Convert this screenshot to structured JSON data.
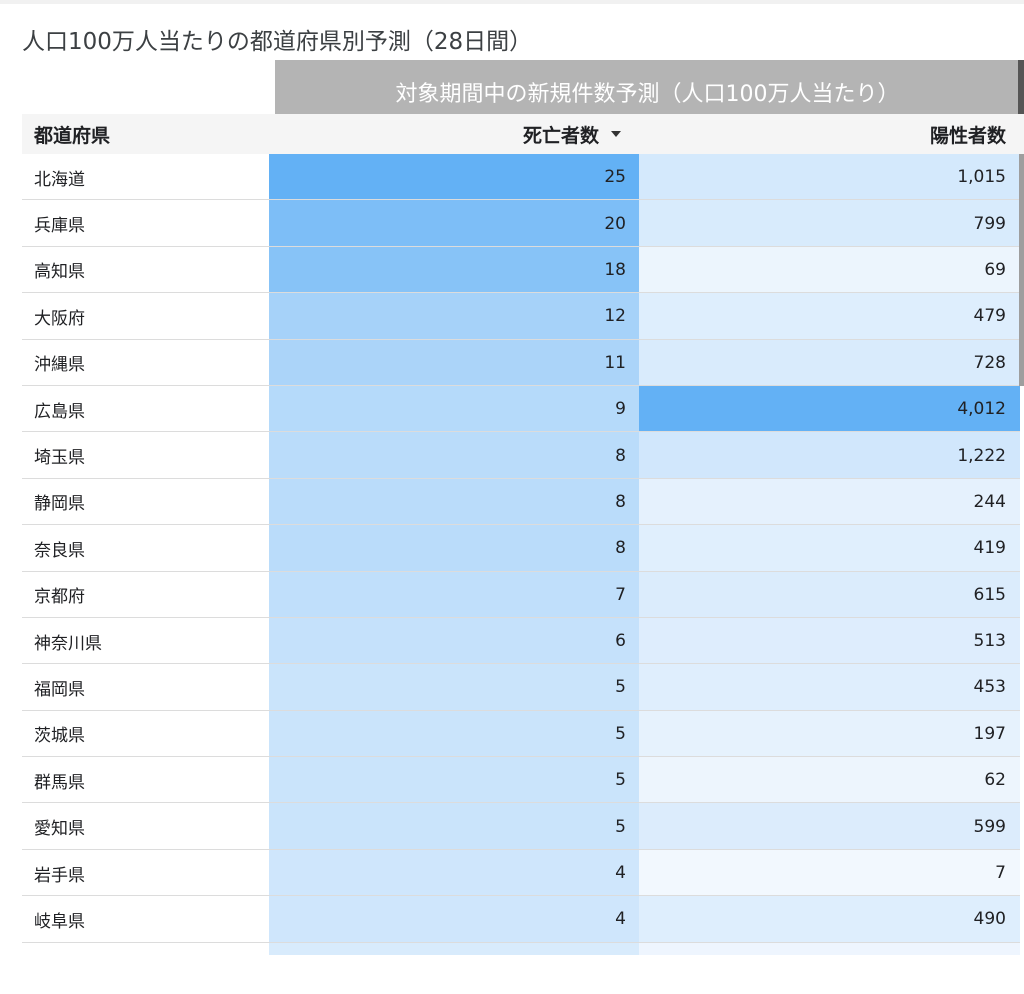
{
  "title": "人口100万人当たりの都道府県別予測（28日間）",
  "group_header": "対象期間中の新規件数予測（人口100万人当たり）",
  "columns": {
    "prefecture": "都道府県",
    "deaths": "死亡者数",
    "positives": "陽性者数"
  },
  "sort": {
    "column": "deaths",
    "direction": "descending",
    "icon": "sort-descending-icon"
  },
  "colors": {
    "scale_light": "#f5f9fe",
    "scale_dark": "#63b1f5",
    "group_header_bg": "#b4b4b4",
    "header_bg": "#f5f5f5"
  },
  "rows": [
    {
      "prefecture": "北海道",
      "deaths": "25",
      "deaths_value": 25,
      "positives": "1,015",
      "positives_value": 1015
    },
    {
      "prefecture": "兵庫県",
      "deaths": "20",
      "deaths_value": 20,
      "positives": "799",
      "positives_value": 799
    },
    {
      "prefecture": "高知県",
      "deaths": "18",
      "deaths_value": 18,
      "positives": "69",
      "positives_value": 69
    },
    {
      "prefecture": "大阪府",
      "deaths": "12",
      "deaths_value": 12,
      "positives": "479",
      "positives_value": 479
    },
    {
      "prefecture": "沖縄県",
      "deaths": "11",
      "deaths_value": 11,
      "positives": "728",
      "positives_value": 728
    },
    {
      "prefecture": "広島県",
      "deaths": "9",
      "deaths_value": 9,
      "positives": "4,012",
      "positives_value": 4012
    },
    {
      "prefecture": "埼玉県",
      "deaths": "8",
      "deaths_value": 8,
      "positives": "1,222",
      "positives_value": 1222
    },
    {
      "prefecture": "静岡県",
      "deaths": "8",
      "deaths_value": 8,
      "positives": "244",
      "positives_value": 244
    },
    {
      "prefecture": "奈良県",
      "deaths": "8",
      "deaths_value": 8,
      "positives": "419",
      "positives_value": 419
    },
    {
      "prefecture": "京都府",
      "deaths": "7",
      "deaths_value": 7,
      "positives": "615",
      "positives_value": 615
    },
    {
      "prefecture": "神奈川県",
      "deaths": "6",
      "deaths_value": 6,
      "positives": "513",
      "positives_value": 513
    },
    {
      "prefecture": "福岡県",
      "deaths": "5",
      "deaths_value": 5,
      "positives": "453",
      "positives_value": 453
    },
    {
      "prefecture": "茨城県",
      "deaths": "5",
      "deaths_value": 5,
      "positives": "197",
      "positives_value": 197
    },
    {
      "prefecture": "群馬県",
      "deaths": "5",
      "deaths_value": 5,
      "positives": "62",
      "positives_value": 62
    },
    {
      "prefecture": "愛知県",
      "deaths": "5",
      "deaths_value": 5,
      "positives": "599",
      "positives_value": 599
    },
    {
      "prefecture": "岩手県",
      "deaths": "4",
      "deaths_value": 4,
      "positives": "7",
      "positives_value": 7
    },
    {
      "prefecture": "岐阜県",
      "deaths": "4",
      "deaths_value": 4,
      "positives": "490",
      "positives_value": 490
    }
  ]
}
